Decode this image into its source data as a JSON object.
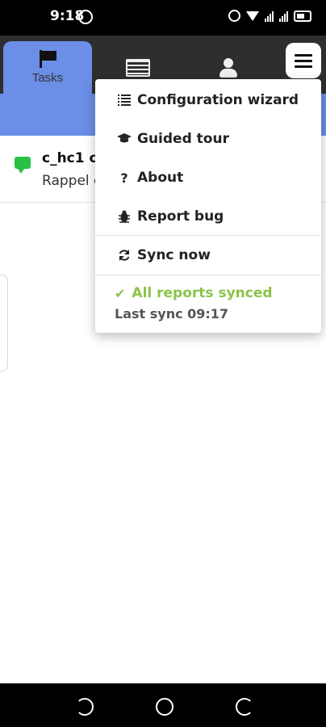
{
  "status_bar": {
    "time": "9:18"
  },
  "tabs": [
    {
      "label": "Tasks",
      "icon": "flag-icon",
      "active": true
    },
    {
      "label": "",
      "icon": "news-icon",
      "active": false
    },
    {
      "label": "",
      "icon": "person-icon",
      "active": false
    }
  ],
  "task": {
    "title": "c_hc1 ce",
    "subtitle": "Rappel c"
  },
  "menu": {
    "items": [
      {
        "icon": "list-icon",
        "label": "Configuration wizard"
      },
      {
        "icon": "graduation-cap-icon",
        "label": "Guided tour"
      },
      {
        "icon": "question-icon",
        "label": "About"
      },
      {
        "icon": "bug-icon",
        "label": "Report bug"
      },
      {
        "icon": "sync-icon",
        "label": "Sync now"
      }
    ],
    "sync_status": "All reports synced",
    "last_sync": "Last sync 09:17"
  },
  "colors": {
    "accent": "#6b8ee6",
    "header": "#2e2e2e",
    "success": "#8bc34a",
    "chat": "#27c244"
  }
}
